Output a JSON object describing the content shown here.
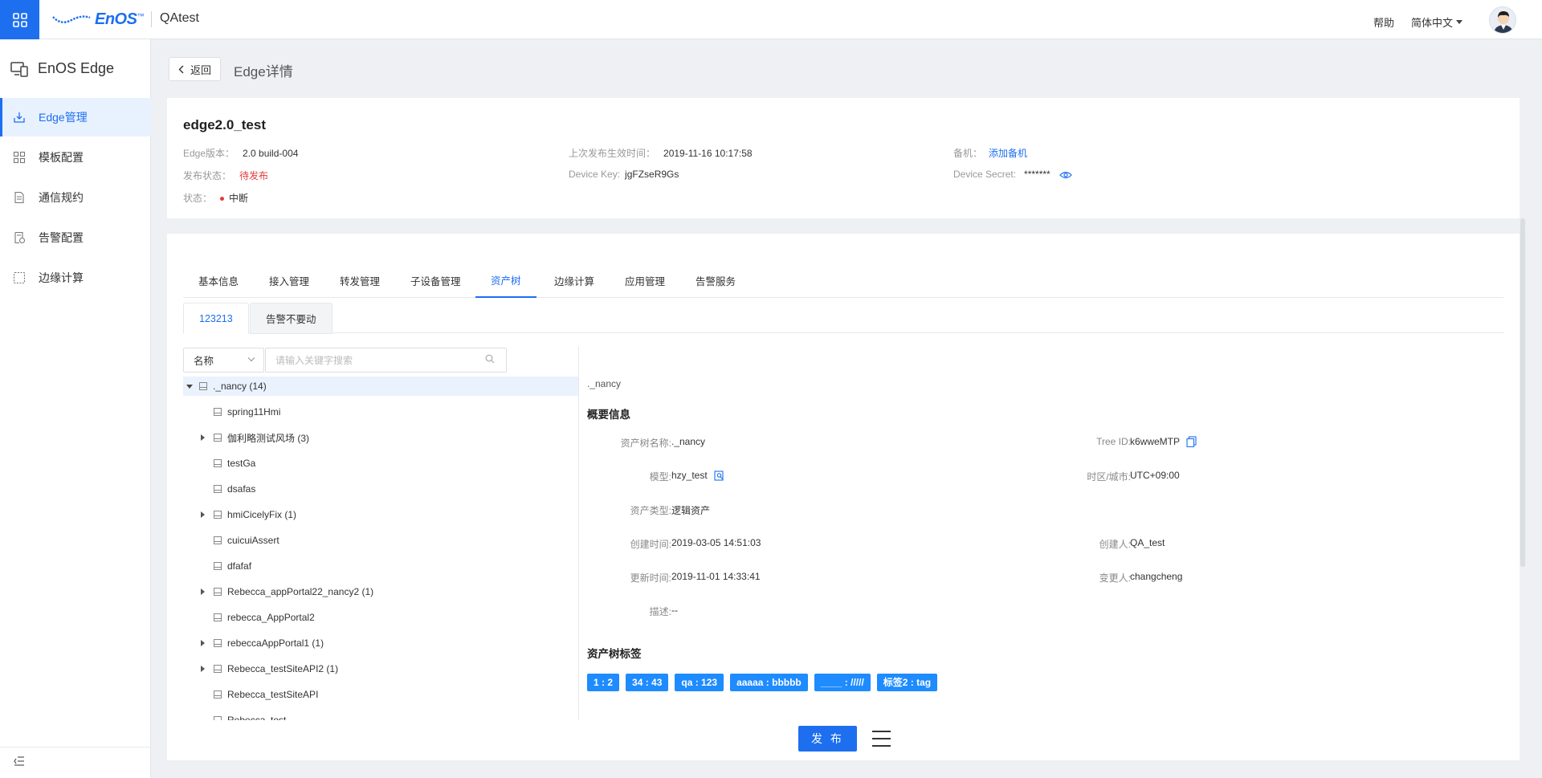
{
  "topbar": {
    "logo_text": "EnOS",
    "logo_tm": "™",
    "app_name": "QAtest",
    "help": "帮助",
    "language": "简体中文"
  },
  "sidebar": {
    "title": "EnOS Edge",
    "items": [
      {
        "label": "Edge管理",
        "icon": "edge-download-icon",
        "active": true
      },
      {
        "label": "模板配置",
        "icon": "template-grid-icon",
        "active": false
      },
      {
        "label": "通信规约",
        "icon": "protocol-doc-icon",
        "active": false
      },
      {
        "label": "告警配置",
        "icon": "alarm-config-icon",
        "active": false
      },
      {
        "label": "边缘计算",
        "icon": "edge-compute-icon",
        "active": false
      }
    ]
  },
  "header": {
    "back_label": "返回",
    "title": "Edge详情"
  },
  "edge": {
    "name": "edge2.0_test",
    "version_label": "Edge版本：",
    "version_value": "2.0 build-004",
    "publish_label": "发布状态：",
    "publish_value": "待发布",
    "status_label": "状态：",
    "status_value": "中断",
    "last_publish_label": "上次发布生效时间：",
    "last_publish_value": "2019-11-16 10:17:58",
    "device_key_label": "Device Key:",
    "device_key_value": "jgFZseR9Gs",
    "standby_label": "备机：",
    "standby_value": "添加备机",
    "device_secret_label": "Device Secret:",
    "device_secret_value": "*******"
  },
  "tabs": [
    "基本信息",
    "接入管理",
    "转发管理",
    "子设备管理",
    "资产树",
    "边缘计算",
    "应用管理",
    "告警服务"
  ],
  "active_tab": "资产树",
  "subtabs": [
    "123213",
    "告警不要动"
  ],
  "filter": {
    "select_value": "名称",
    "search_placeholder": "请输入关键字搜索"
  },
  "tree": [
    {
      "label": "._nancy (14)",
      "level": 0,
      "toggle": "open",
      "selected": true
    },
    {
      "label": "spring11Hmi",
      "level": 1,
      "toggle": "none"
    },
    {
      "label": "伽利略测试风场 (3)",
      "level": 1,
      "toggle": "closed"
    },
    {
      "label": "testGa",
      "level": 1,
      "toggle": "none"
    },
    {
      "label": "dsafas",
      "level": 1,
      "toggle": "none"
    },
    {
      "label": "hmiCicelyFix (1)",
      "level": 1,
      "toggle": "closed"
    },
    {
      "label": "cuicuiAssert",
      "level": 1,
      "toggle": "none"
    },
    {
      "label": "dfafaf",
      "level": 1,
      "toggle": "none"
    },
    {
      "label": "Rebecca_appPortal22_nancy2 (1)",
      "level": 1,
      "toggle": "closed"
    },
    {
      "label": "rebecca_AppPortal2",
      "level": 1,
      "toggle": "none"
    },
    {
      "label": "rebeccaAppPortal1 (1)",
      "level": 1,
      "toggle": "closed"
    },
    {
      "label": "Rebecca_testSiteAPI2 (1)",
      "level": 1,
      "toggle": "closed"
    },
    {
      "label": "Rebecca_testSiteAPI",
      "level": 1,
      "toggle": "none"
    },
    {
      "label": "Rebecca_test",
      "level": 1,
      "toggle": "none"
    }
  ],
  "detail": {
    "node_name": "._nancy",
    "summary_title": "概要信息",
    "fields_left": [
      {
        "label": "资产树名称:",
        "value": "._nancy"
      },
      {
        "label": "模型:",
        "value": "hzy_test"
      },
      {
        "label": "资产类型:",
        "value": "逻辑资产"
      },
      {
        "label": "创建时间:",
        "value": "2019-03-05 14:51:03"
      },
      {
        "label": "更新时间:",
        "value": "2019-11-01 14:33:41"
      },
      {
        "label": "描述:",
        "value": "--"
      }
    ],
    "fields_right": [
      {
        "label": "Tree ID:",
        "value": "k6wweMTP"
      },
      {
        "label": "时区/城市:",
        "value": "UTC+09:00"
      },
      {
        "label": "创建人:",
        "value": "QA_test"
      },
      {
        "label": "变更人:",
        "value": "changcheng"
      }
    ],
    "tags_title": "资产树标签",
    "tags": [
      "1 : 2",
      "34 : 43",
      "qa : 123",
      "aaaaa : bbbbb",
      "____ : /////",
      "标签2 : tag"
    ]
  },
  "footer": {
    "publish_label": "发 布"
  },
  "colors": {
    "accent": "#1d6ff0",
    "danger": "#e53b3b",
    "tag": "#1e8bff"
  }
}
